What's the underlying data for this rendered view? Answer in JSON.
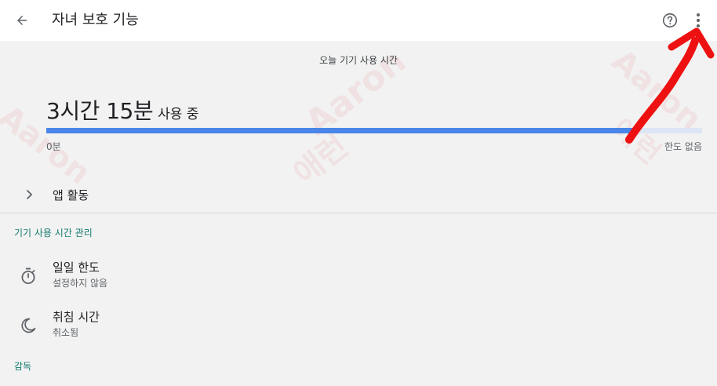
{
  "appbar": {
    "title": "자녀 보호 기능",
    "back_icon": "arrow-back-icon",
    "help_icon": "help-circle-icon",
    "more_icon": "more-vert-icon"
  },
  "usage": {
    "caption": "오늘 기기 사용 시간",
    "time": "3시간 15분",
    "suffix": "사용 중",
    "progress_fraction": 0.9,
    "range_min": "0분",
    "range_max": "한도 없음"
  },
  "app_activity": {
    "label": "앱 활동",
    "icon": "chevron-right-icon"
  },
  "screen_time_section": {
    "header": "기기 사용 시간 관리",
    "items": [
      {
        "title": "일일 한도",
        "subtitle": "설정하지 않음",
        "icon": "timer-icon"
      },
      {
        "title": "취침 시간",
        "subtitle": "취소됨",
        "icon": "moon-icon"
      }
    ]
  },
  "supervision_section": {
    "header": "감독"
  },
  "watermark": {
    "line1": "Aaron",
    "line2": "애런"
  },
  "colors": {
    "accent_teal": "#127a6e",
    "progress_blue": "#4a86e8",
    "progress_track": "#dde6f5",
    "annotation_red": "#ee1111"
  }
}
